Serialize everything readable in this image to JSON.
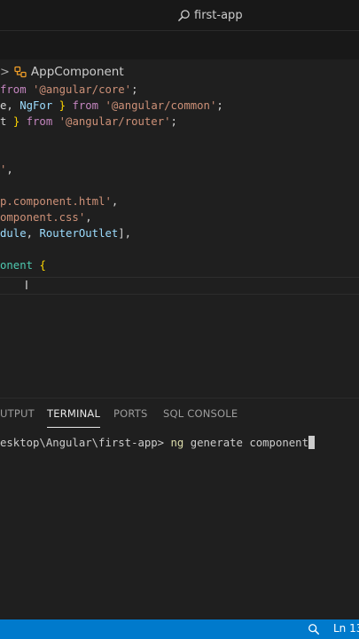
{
  "title_bar": {
    "search_text": "first-app"
  },
  "breadcrumb": {
    "separator": ">",
    "symbol_icon": "class-symbol-icon",
    "item": "AppComponent"
  },
  "code_lines": [
    {
      "tokens": [
        {
          "t": "kw",
          "v": "from"
        },
        {
          "t": "punct",
          "v": " "
        },
        {
          "t": "str",
          "v": "'@angular/core'"
        },
        {
          "t": "punct",
          "v": ";"
        }
      ]
    },
    {
      "tokens": [
        {
          "t": "punct",
          "v": "e, "
        },
        {
          "t": "ident",
          "v": "NgFor"
        },
        {
          "t": "punct",
          "v": " "
        },
        {
          "t": "brace",
          "v": "}"
        },
        {
          "t": "punct",
          "v": " "
        },
        {
          "t": "kw",
          "v": "from"
        },
        {
          "t": "punct",
          "v": " "
        },
        {
          "t": "str",
          "v": "'@angular/common'"
        },
        {
          "t": "punct",
          "v": ";"
        }
      ]
    },
    {
      "tokens": [
        {
          "t": "punct",
          "v": "t "
        },
        {
          "t": "brace",
          "v": "}"
        },
        {
          "t": "punct",
          "v": " "
        },
        {
          "t": "kw",
          "v": "from"
        },
        {
          "t": "punct",
          "v": " "
        },
        {
          "t": "str",
          "v": "'@angular/router'"
        },
        {
          "t": "punct",
          "v": ";"
        }
      ]
    },
    {
      "tokens": [
        {
          "t": "str",
          "v": "'"
        },
        {
          "t": "punct",
          "v": ","
        }
      ]
    },
    {
      "tokens": [
        {
          "t": "str",
          "v": "p.component.html'"
        },
        {
          "t": "punct",
          "v": ","
        }
      ]
    },
    {
      "tokens": [
        {
          "t": "str",
          "v": "omponent.css'"
        },
        {
          "t": "punct",
          "v": ","
        }
      ]
    },
    {
      "tokens": [
        {
          "t": "ident",
          "v": "dule"
        },
        {
          "t": "punct",
          "v": ", "
        },
        {
          "t": "ident",
          "v": "RouterOutlet"
        },
        {
          "t": "punct",
          "v": "],"
        }
      ]
    },
    {
      "tokens": [
        {
          "t": "cls",
          "v": "onent"
        },
        {
          "t": "punct",
          "v": " "
        },
        {
          "t": "brace",
          "v": "{"
        }
      ]
    }
  ],
  "panel": {
    "tabs": [
      {
        "label": "UTPUT",
        "active": false
      },
      {
        "label": "TERMINAL",
        "active": true
      },
      {
        "label": "PORTS",
        "active": false
      },
      {
        "label": "SQL CONSOLE",
        "active": false
      }
    ]
  },
  "terminal": {
    "prompt": "esktop\\Angular\\first-app> ",
    "command": "ng",
    "args": " generate component"
  },
  "status_bar": {
    "zoom_icon": "zoom-icon",
    "position": "Ln 13"
  },
  "colors": {
    "status_bar": "#007acc",
    "editor_bg": "#1f1f1f"
  }
}
